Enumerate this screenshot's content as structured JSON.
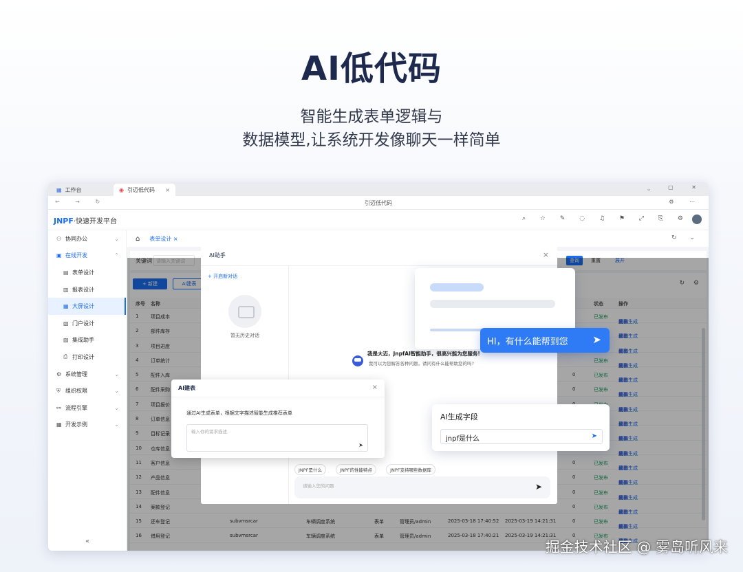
{
  "hero": {
    "title": "AI低代码",
    "subtitle_line1": "智能生成表单逻辑与",
    "subtitle_line2": "数据模型,让系统开发像聊天一样简单"
  },
  "browser": {
    "tabs": [
      {
        "label": "工作台"
      },
      {
        "label": "引迈低代码"
      }
    ],
    "url_text": "引迈低代码"
  },
  "app": {
    "logo_brand": "JNPF",
    "logo_text": "·快速开发平台"
  },
  "sidebar": {
    "items": [
      {
        "label": "协同办公",
        "level": 1
      },
      {
        "label": "在线开发",
        "level": 1,
        "open": true
      },
      {
        "label": "表单设计",
        "level": 2
      },
      {
        "label": "报表设计",
        "level": 2
      },
      {
        "label": "大屏设计",
        "level": 2,
        "active": true
      },
      {
        "label": "门户设计",
        "level": 2
      },
      {
        "label": "集成助手",
        "level": 2
      },
      {
        "label": "打印设计",
        "level": 2
      },
      {
        "label": "系统管理",
        "level": 1
      },
      {
        "label": "组织权限",
        "level": 1
      },
      {
        "label": "流程引擎",
        "level": 1
      },
      {
        "label": "开发示例",
        "level": 1
      }
    ],
    "collapse_glyph": "«"
  },
  "breadcrumb": {
    "tab_label": "表单设计 ×"
  },
  "search": {
    "label": "关键词",
    "placeholder": "请输入关键词",
    "query_label": "查询",
    "reset_label": "重置",
    "expand_label": "展开"
  },
  "toolbar": {
    "new_label": "+ 新建",
    "ai_label": "AI建表"
  },
  "table": {
    "headers": {
      "no": "序号",
      "name": "名称",
      "status": "状态",
      "ops": "操作"
    },
    "rows": [
      {
        "no": "1",
        "name": "项目成本",
        "code": "",
        "cat": "",
        "type": "",
        "creator": "",
        "created": "",
        "updated": "",
        "sort": "",
        "status": "已发布"
      },
      {
        "no": "2",
        "name": "部件库存",
        "code": "",
        "cat": "",
        "type": "",
        "creator": "",
        "created": "",
        "updated": "",
        "sort": "",
        "status": "已发布"
      },
      {
        "no": "3",
        "name": "项目进度",
        "code": "",
        "cat": "",
        "type": "",
        "creator": "",
        "created": "",
        "updated": "",
        "sort": "",
        "status": "已发布"
      },
      {
        "no": "4",
        "name": "订单统计",
        "code": "",
        "cat": "",
        "type": "",
        "creator": "",
        "created": "",
        "updated": "",
        "sort": "",
        "status": "已发布"
      },
      {
        "no": "5",
        "name": "配件入库",
        "code": "",
        "cat": "",
        "type": "",
        "creator": "",
        "created": "",
        "updated": "",
        "sort": "0",
        "status": "已发布"
      },
      {
        "no": "6",
        "name": "配件采购",
        "code": "",
        "cat": "",
        "type": "",
        "creator": "",
        "created": "",
        "updated": "",
        "sort": "0",
        "status": "已发布"
      },
      {
        "no": "7",
        "name": "项目报价",
        "code": "",
        "cat": "",
        "type": "",
        "creator": "",
        "created": "",
        "updated": "",
        "sort": "0",
        "status": "已发布"
      },
      {
        "no": "8",
        "name": "订单信息",
        "code": "",
        "cat": "",
        "type": "",
        "creator": "",
        "created": "",
        "updated": "",
        "sort": "0",
        "status": "已发布"
      },
      {
        "no": "9",
        "name": "目标记录",
        "code": "",
        "cat": "",
        "type": "",
        "creator": "",
        "created": "",
        "updated": "",
        "sort": "0",
        "status": "已发布"
      },
      {
        "no": "10",
        "name": "仓库信息",
        "code": "",
        "cat": "",
        "type": "",
        "creator": "",
        "created": "",
        "updated": "",
        "sort": "0",
        "status": "已发布"
      },
      {
        "no": "11",
        "name": "客户信息",
        "code": "",
        "cat": "",
        "type": "",
        "creator": "",
        "created": "",
        "updated": "",
        "sort": "0",
        "status": "已发布"
      },
      {
        "no": "12",
        "name": "产品信息",
        "code": "",
        "cat": "",
        "type": "",
        "creator": "",
        "created": "",
        "updated": "",
        "sort": "0",
        "status": "已发布"
      },
      {
        "no": "13",
        "name": "配件信息",
        "code": "",
        "cat": "",
        "type": "",
        "creator": "",
        "created": "",
        "updated": "",
        "sort": "0",
        "status": "已发布"
      },
      {
        "no": "14",
        "name": "案款登记",
        "code": "",
        "cat": "",
        "type": "",
        "creator": "",
        "created": "",
        "updated": "",
        "sort": "0",
        "status": "已发布"
      },
      {
        "no": "15",
        "name": "还车登记",
        "code": "subvmsrcar",
        "cat": "车辆调度系统",
        "type": "表单",
        "creator": "管理员/admin",
        "created": "2025-03-18 17:40:52",
        "updated": "2025-03-19 14:21:31",
        "sort": "0",
        "status": "已发布"
      },
      {
        "no": "16",
        "name": "借用登记",
        "code": "subvmsrcar",
        "cat": "车辆调度系统",
        "type": "表单",
        "creator": "管理员/admin",
        "created": "2025-03-18 17:40:21",
        "updated": "2025-03-19 14:21:31",
        "sort": "0",
        "status": "已发布"
      }
    ],
    "ops": {
      "edit": "编辑",
      "publish": "发布",
      "codegen": "代码生成",
      "more": "更多"
    }
  },
  "dialog_assistant": {
    "title": "AI助手",
    "new_chat": "+ 开启新对话",
    "no_history": "暂无历史对话",
    "welcome_line1": "我是大迈，JnpfAI智能助手，很高兴能为您服务!",
    "welcome_line2": "我可以为您解答各种问题，请问有什么能帮助您的吗?",
    "chips": [
      "JNPF是什么",
      "JNPF的性能特点",
      "JNPF支持哪些数据库"
    ],
    "input_placeholder": "请输入您的问题"
  },
  "dialog_aiform": {
    "title": "AI建表",
    "description": "通过AI生成表单，根据文字描述智能生成推荐表单",
    "input_placeholder": "输入你的需求描述"
  },
  "float_hi": {
    "text": "HI，有什么能帮到您"
  },
  "float_field": {
    "title": "AI生成字段",
    "input_value": "jnpf是什么"
  },
  "watermark": {
    "text": "掘金技术社区 @ 雾岛听风来"
  },
  "colors": {
    "brand_blue": "#1b6df0",
    "hero_title": "#1d2a4d",
    "success": "#1aa260"
  }
}
